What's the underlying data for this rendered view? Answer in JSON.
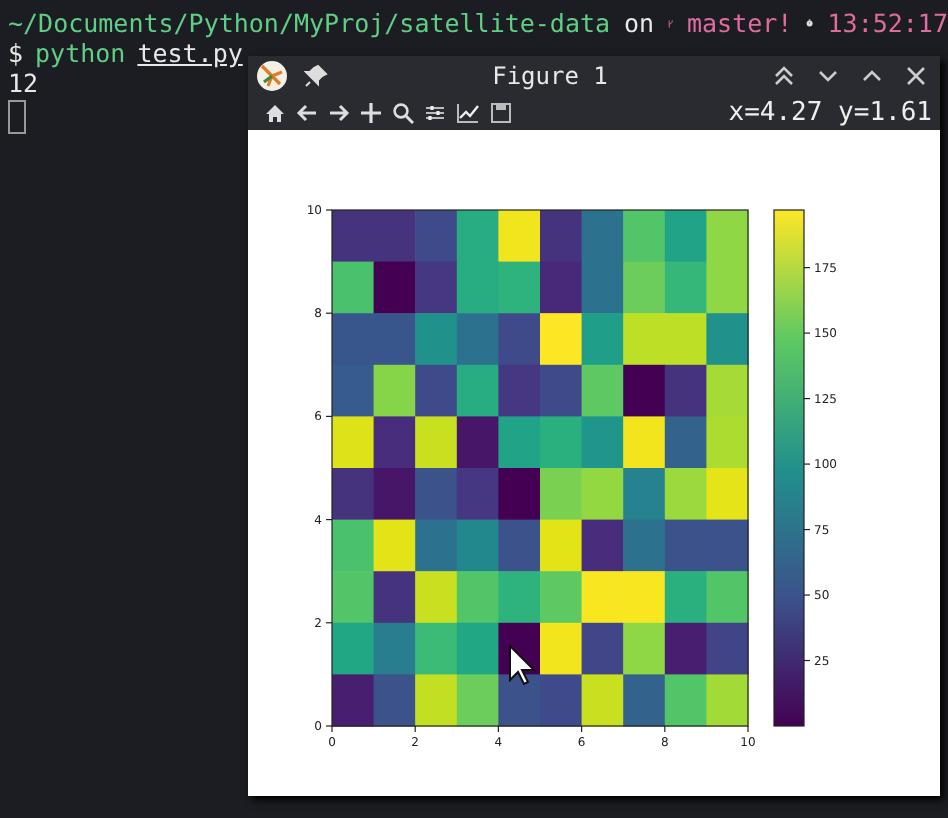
{
  "terminal": {
    "path": "~/Documents/Python/MyProj/satellite-data",
    "on": "on",
    "branch": "master!",
    "time": "13:52:17",
    "prompt": "$",
    "command": "python",
    "argument": "test.py",
    "output": "12"
  },
  "figure_window": {
    "title": "Figure 1",
    "coordinates": "x=4.27 y=1.61",
    "heatmap": {
      "rows": [
        {
          "cells": [
            {
              "color": "#46337e"
            },
            {
              "color": "#46337e"
            },
            {
              "color": "#3e4a89"
            },
            {
              "color": "#27ad81"
            },
            {
              "color": "#f1e51d"
            },
            {
              "color": "#46337e"
            },
            {
              "color": "#2c728e"
            },
            {
              "color": "#52c569"
            },
            {
              "color": "#20a386"
            },
            {
              "color": "#8fd744"
            }
          ]
        },
        {
          "cells": [
            {
              "color": "#4ac16d"
            },
            {
              "color": "#440154"
            },
            {
              "color": "#453781"
            },
            {
              "color": "#27ad81"
            },
            {
              "color": "#2eb37c"
            },
            {
              "color": "#482878"
            },
            {
              "color": "#2c728e"
            },
            {
              "color": "#6ccd5a"
            },
            {
              "color": "#35b779"
            },
            {
              "color": "#8fd744"
            }
          ]
        },
        {
          "cells": [
            {
              "color": "#39568c"
            },
            {
              "color": "#39568c"
            },
            {
              "color": "#21918c"
            },
            {
              "color": "#2c728e"
            },
            {
              "color": "#3e4a89"
            },
            {
              "color": "#fde725"
            },
            {
              "color": "#1f9e89"
            },
            {
              "color": "#bddf26"
            },
            {
              "color": "#bddf26"
            },
            {
              "color": "#21918c"
            }
          ]
        },
        {
          "cells": [
            {
              "color": "#365c8d"
            },
            {
              "color": "#86d549"
            },
            {
              "color": "#3e4a89"
            },
            {
              "color": "#27ad81"
            },
            {
              "color": "#453781"
            },
            {
              "color": "#3e4a89"
            },
            {
              "color": "#5ec962"
            },
            {
              "color": "#440154"
            },
            {
              "color": "#46337e"
            },
            {
              "color": "#a5db36"
            }
          ]
        },
        {
          "cells": [
            {
              "color": "#dde318"
            },
            {
              "color": "#472d7b"
            },
            {
              "color": "#c8e020"
            },
            {
              "color": "#481668"
            },
            {
              "color": "#20a386"
            },
            {
              "color": "#2ab07f"
            },
            {
              "color": "#1f958b"
            },
            {
              "color": "#f1e51d"
            },
            {
              "color": "#33638d"
            },
            {
              "color": "#addc30"
            }
          ]
        },
        {
          "cells": [
            {
              "color": "#46337e"
            },
            {
              "color": "#481668"
            },
            {
              "color": "#3b528b"
            },
            {
              "color": "#453781"
            },
            {
              "color": "#440154"
            },
            {
              "color": "#7ad151"
            },
            {
              "color": "#93d741"
            },
            {
              "color": "#26828e"
            },
            {
              "color": "#9bd93c"
            },
            {
              "color": "#e5e419"
            }
          ]
        },
        {
          "cells": [
            {
              "color": "#4ac16d"
            },
            {
              "color": "#e2e418"
            },
            {
              "color": "#2c728e"
            },
            {
              "color": "#23888e"
            },
            {
              "color": "#3b528b"
            },
            {
              "color": "#e2e418"
            },
            {
              "color": "#472d7b"
            },
            {
              "color": "#2c728e"
            },
            {
              "color": "#3b528b"
            },
            {
              "color": "#3b528b"
            }
          ]
        },
        {
          "cells": [
            {
              "color": "#52c569"
            },
            {
              "color": "#46337e"
            },
            {
              "color": "#c8e020"
            },
            {
              "color": "#52c569"
            },
            {
              "color": "#2eb37c"
            },
            {
              "color": "#5ec962"
            },
            {
              "color": "#f8e621"
            },
            {
              "color": "#f8e621"
            },
            {
              "color": "#2ab07f"
            },
            {
              "color": "#52c569"
            }
          ]
        },
        {
          "cells": [
            {
              "color": "#22a785"
            },
            {
              "color": "#287d8e"
            },
            {
              "color": "#3bbb75"
            },
            {
              "color": "#22a785"
            },
            {
              "color": "#440154"
            },
            {
              "color": "#f1e51d"
            },
            {
              "color": "#404688"
            },
            {
              "color": "#8fd744"
            },
            {
              "color": "#481f70"
            },
            {
              "color": "#414487"
            }
          ]
        },
        {
          "cells": [
            {
              "color": "#481f70"
            },
            {
              "color": "#3b528b"
            },
            {
              "color": "#c2df23"
            },
            {
              "color": "#6ccd5a"
            },
            {
              "color": "#3b528b"
            },
            {
              "color": "#3e4a89"
            },
            {
              "color": "#c8e020"
            },
            {
              "color": "#33638d"
            },
            {
              "color": "#52c569"
            },
            {
              "color": "#a2da37"
            }
          ]
        }
      ],
      "xticks": [
        "0",
        "2",
        "4",
        "6",
        "8",
        "10"
      ],
      "yticks": [
        "10",
        "8",
        "6",
        "4",
        "2",
        "0"
      ],
      "colorbar_ticks": [
        "175",
        "150",
        "125",
        "100",
        "75",
        "50",
        "25"
      ]
    }
  }
}
